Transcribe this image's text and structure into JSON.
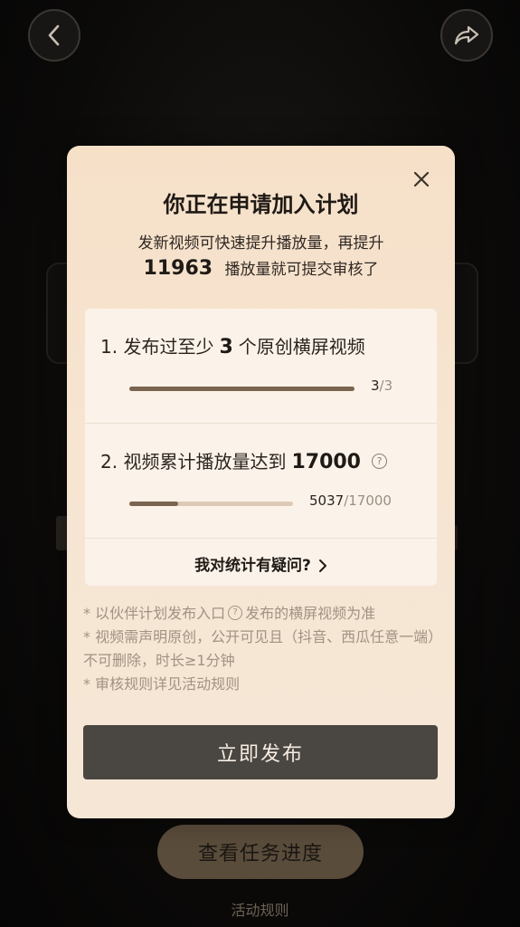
{
  "header": {
    "back_icon": "chevron-left-icon",
    "share_icon": "share-arrow-icon"
  },
  "background": {
    "progress_button_label": "查看任务进度",
    "rules_link": "活动规则"
  },
  "modal": {
    "close_icon": "close-icon",
    "title": "你正在申请加入计划",
    "subtitle_line1": "发新视频可快速提升播放量，再提升",
    "subtitle_number": "11963",
    "subtitle_line2": "播放量就可提交审核了",
    "requirements": [
      {
        "prefix": "1. 发布过至少",
        "number": "3",
        "suffix": "个原创横屏视频",
        "current": "3",
        "total": "/3",
        "progress": 1.0
      },
      {
        "prefix": "2. 视频累计播放量达到",
        "number": "17000",
        "suffix": "",
        "current": "5037",
        "total": "/17000",
        "progress": 0.2963
      }
    ],
    "question_icon": "?",
    "doubt_link": "我对统计有疑问?",
    "notes": {
      "note1_before": "* 以伙伴计划发布入口",
      "note1_after": "发布的横屏视频为准",
      "note2": "* 视频需声明原创，公开可见且（抖音、西瓜任意一端）不可删除，时长≥1分钟",
      "note3": "* 审核规则详见活动规则"
    },
    "publish_button": "立即发布"
  },
  "colors": {
    "accent_dark": "#4a4641",
    "progress_fill": "#7b6550",
    "modal_bg": "#f6e0c8"
  }
}
